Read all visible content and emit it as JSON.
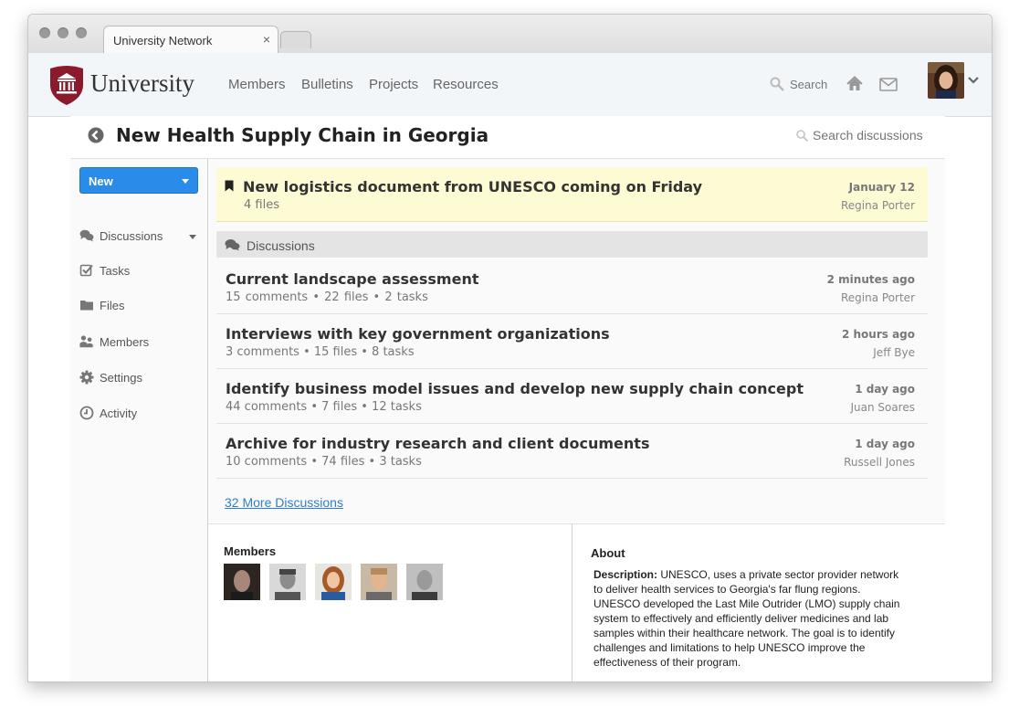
{
  "browser": {
    "tab_title": "University Network",
    "tab_close": "×"
  },
  "nav": {
    "brand": "University",
    "menu": [
      "Members",
      "Bulletins",
      "Projects",
      "Resources"
    ],
    "search_placeholder": "Search"
  },
  "page": {
    "title": "New Health Supply Chain in Georgia",
    "search_placeholder": "Search discussions"
  },
  "sidebar": {
    "new_label": "New",
    "items": [
      {
        "label": "Discussions",
        "icon": "comments-icon"
      },
      {
        "label": "Tasks",
        "icon": "checkbox-icon"
      },
      {
        "label": "Files",
        "icon": "folder-icon"
      },
      {
        "label": "Members",
        "icon": "users-icon"
      },
      {
        "label": "Settings",
        "icon": "gear-icon"
      },
      {
        "label": "Activity",
        "icon": "clock-icon"
      }
    ]
  },
  "pinned": {
    "title": "New logistics document from UNESCO coming on Friday",
    "subtitle": "4 files",
    "date": "January 12",
    "author": "Regina Porter"
  },
  "discussions": {
    "header": "Discussions",
    "items": [
      {
        "title": "Current landscape assessment",
        "meta": "15 comments  •  22 files  •  2 tasks",
        "time": "2 minutes ago",
        "author": "Regina Porter"
      },
      {
        "title": "Interviews with key government organizations",
        "meta": "3 comments  •  15 files  •  8 tasks",
        "time": "2 hours ago",
        "author": "Jeff Bye"
      },
      {
        "title": "Identify business model issues and develop new supply chain concept",
        "meta": "44 comments  •  7 files  •  12 tasks",
        "time": "1 day ago",
        "author": "Juan Soares"
      },
      {
        "title": "Archive for industry research and client documents",
        "meta": "10 comments  •  74 files  •  3 tasks",
        "time": "1 day ago",
        "author": "Russell Jones"
      }
    ],
    "more_link": "32 More Discussions"
  },
  "members": {
    "title": "Members"
  },
  "about": {
    "title": "About",
    "desc_label": "Description:",
    "desc_text": " UNESCO, uses a private sector provider network to deliver health services to Georgia's far flung regions. UNESCO developed the Last Mile Outrider (LMO) supply chain system to effectively and efficiently deliver medicines and lab samples within their healthcare network. The goal is to identify challenges and limitations to help UNESCO improve the effectiveness of their program."
  },
  "colors": {
    "brand_red": "#8b1b2c",
    "primary_blue": "#2b8be8",
    "pinned_bg": "#fdfbd4",
    "link_blue": "#2f7fc8"
  }
}
